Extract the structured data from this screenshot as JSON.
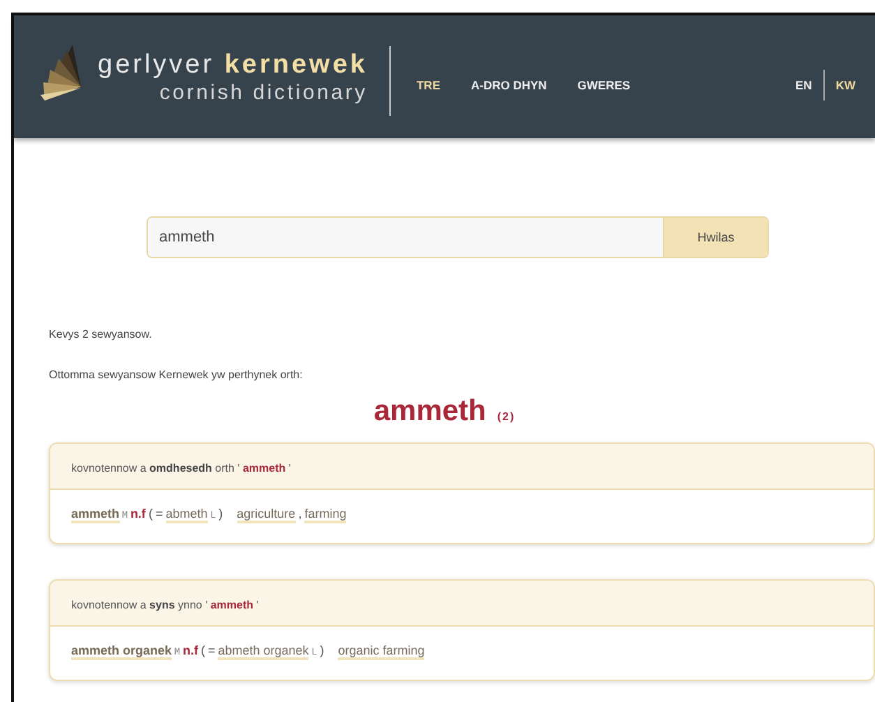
{
  "header": {
    "title_light": "gerlyver",
    "title_bold": "kernewek",
    "subtitle": "cornish dictionary",
    "nav": [
      {
        "label": "TRE",
        "selected": true
      },
      {
        "label": "A-DRO DHYN",
        "selected": false
      },
      {
        "label": "GWERES",
        "selected": false
      }
    ],
    "languages": [
      {
        "label": "EN",
        "selected": false
      },
      {
        "label": "KW",
        "selected": true
      }
    ]
  },
  "search": {
    "value": "ammeth",
    "button": "Hwilas"
  },
  "result_count": "Kevys 2 sewyansow.",
  "intro": "Ottomma sewyansow Kernewek yw perthynek orth:",
  "headword": {
    "word": "ammeth",
    "count": "(2)"
  },
  "cards": [
    {
      "header": {
        "text": "kovnotennow a **omdhesedh** orth '",
        "term": "ammeth",
        "after": "'"
      },
      "entry": {
        "headword": "ammeth",
        "mark": "M",
        "pos": "n.f",
        "open": "(",
        "equals": "=",
        "variant": "abmeth",
        "variant_mark": "L",
        "close": ")",
        "translations": [
          {
            "text": "agriculture",
            "separator": ","
          },
          {
            "text": "farming"
          }
        ]
      }
    },
    {
      "header": {
        "text": "kovnotennow a **syns** ynno '",
        "term": "ammeth",
        "after": "'"
      },
      "entry": {
        "headword": "ammeth organek",
        "mark": "M",
        "pos": "n.f",
        "open": "(",
        "equals": "=",
        "variant": "abmeth organek",
        "variant_mark": "L",
        "close": ")",
        "translations": [
          {
            "text": "organic farming"
          }
        ]
      }
    }
  ]
}
